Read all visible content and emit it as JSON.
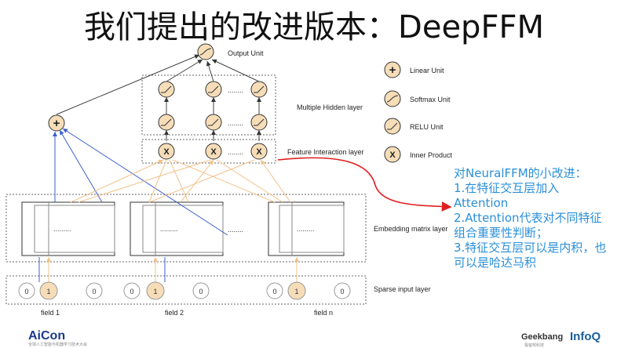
{
  "title": "我们提出的改进版本：DeepFFM",
  "diagram": {
    "output_unit": "Output Unit",
    "hidden_layer": "Multiple Hidden layer",
    "feature_interaction_layer": "Feature Interaction layer",
    "embedding_layer": "Embedding matrix layer",
    "sparse_input_layer": "Sparse input layer",
    "hidden_dots": "........",
    "fi_dots": "........",
    "embed_dots": ".........",
    "between_fields": "........",
    "inner_product_symbol": "X",
    "linear_symbol": "+",
    "fields": [
      "field 1",
      "field 2",
      "field n"
    ],
    "sparse_values": [
      [
        "0",
        "1",
        "0"
      ],
      [
        "0",
        "1",
        "0"
      ],
      [
        "0",
        "1",
        "0"
      ]
    ]
  },
  "legend": [
    {
      "icon": "linear-unit-icon",
      "label": "Linear Unit"
    },
    {
      "icon": "softmax-unit-icon",
      "label": "Softmax Unit"
    },
    {
      "icon": "relu-unit-icon",
      "label": "RELU Unit"
    },
    {
      "icon": "inner-product-icon",
      "label": "Inner Product"
    }
  ],
  "note": {
    "lines": [
      "对NeuralFFM的小改进：",
      "1.在特征交互层加入",
      "Attention",
      "2.Attention代表对不同特征",
      "组合重要性判断；",
      "3.特征交互层可以是内积，也",
      "可以是哈达马积"
    ]
  },
  "footer": {
    "left_logo": "AiCon",
    "left_sub": "全球人工智能与机器学习技术大会",
    "right_logo_1": "Geekbang",
    "right_logo_1_sub": "极客邦科技",
    "right_logo_2": "InfoQ"
  },
  "colors": {
    "node_fill": "#f6ddb8",
    "node_stroke": "#333333",
    "blue_edge": "#3a5fd0",
    "orange_edge": "#f2c28a",
    "red_arrow": "#e02020",
    "note_text": "#2a8fd8"
  }
}
